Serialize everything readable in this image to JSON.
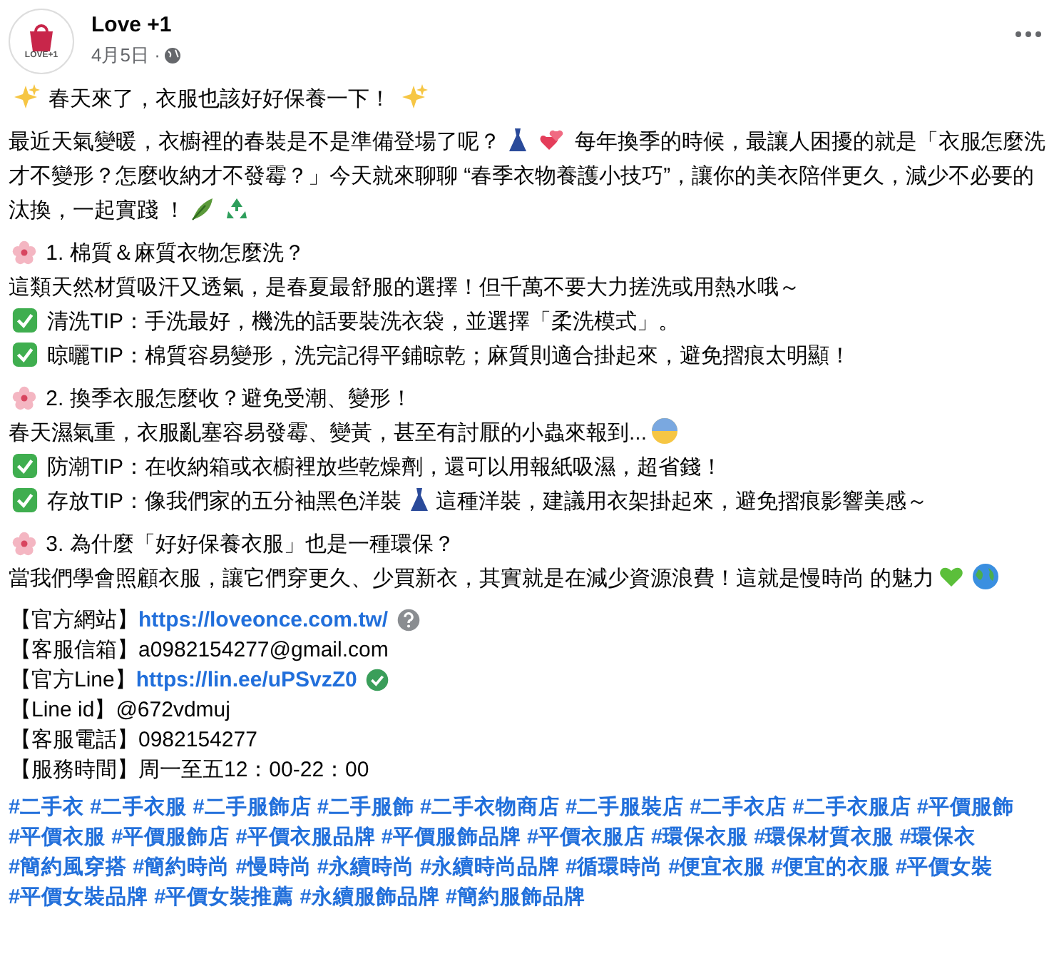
{
  "post": {
    "page_name": "Love +1",
    "date": "4月5日 ·",
    "avatar_text": "LOVE+1"
  },
  "title": "春天來了，衣服也該好好保養一下！",
  "intro": [
    "最近天氣變暖，衣櫥裡的春裝是不是準備登場了呢？",
    "每年換季的時候，最讓人困擾的就是「衣服怎麼洗才不變形？怎麼收納才不發霉？」今天就來聊聊 “春季衣物養護小技巧”，讓你的美衣陪伴更久，減少不必要的汰換，一起實踐 ！"
  ],
  "sections": [
    {
      "heading": "1. 棉質＆麻質衣物怎麼洗？",
      "body": "這類天然材質吸汗又透氣，是春夏最舒服的選擇！但千萬不要大力搓洗或用熱水哦～",
      "tips": [
        [
          "清洗TIP：手洗最好，機洗的話要裝洗衣袋，並選擇「柔洗模式」。"
        ],
        [
          "晾曬TIP：棉質容易變形，洗完記得平鋪晾乾；麻質則適合掛起來，避免摺痕太明顯！"
        ]
      ]
    },
    {
      "heading": "2. 換季衣服怎麼收？避免受潮、變形！",
      "body": "春天濕氣重，衣服亂塞容易發霉、變黃，甚至有討厭的小蟲來報到...",
      "tips": [
        [
          "防潮TIP：在收納箱或衣櫥裡放些乾燥劑，還可以用報紙吸濕，超省錢！"
        ],
        [
          "存放TIP：像我們家的五分袖黑色洋裝",
          "這種洋裝，建議用衣架掛起來，避免摺痕影響美感～"
        ]
      ]
    },
    {
      "heading": "3. 為什麼「好好保養衣服」也是一種環保？",
      "body": "當我們學會照顧衣服，讓它們穿更久、少買新衣，其實就是在減少資源浪費！這就是慢時尚 的魅力"
    }
  ],
  "contacts": [
    {
      "label": "【官方網站】",
      "value": "https://loveonce.com.tw/",
      "kind": "link"
    },
    {
      "label": "【客服信箱】",
      "value": "a0982154277@gmail.com",
      "kind": "plain"
    },
    {
      "label": "【官方Line】",
      "value": "https://lin.ee/uPSvzZ0",
      "kind": "link"
    },
    {
      "label": "【Line id】",
      "value": "@672vdmuj",
      "kind": "plain"
    },
    {
      "label": "【客服電話】",
      "value": "0982154277",
      "kind": "plain"
    },
    {
      "label": "【服務時間】",
      "value": "周一至五12：00-22：00",
      "kind": "plain"
    }
  ],
  "hashtags": [
    "#二手衣",
    "#二手衣服",
    "#二手服飾店",
    "#二手服飾",
    "#二手衣物商店",
    "#二手服裝店",
    "#二手衣店",
    "#二手衣服店",
    "#平價服飾",
    "#平價衣服",
    "#平價服飾店",
    "#平價衣服品牌",
    "#平價服飾品牌",
    "#平價衣服店",
    "#環保衣服",
    "#環保材質衣服",
    "#環保衣",
    "#簡約風穿搭",
    "#簡約時尚",
    "#慢時尚",
    "#永續時尚",
    "#永續時尚品牌",
    "#循環時尚",
    "#便宜衣服",
    "#便宜的衣服",
    "#平價女裝",
    "#平價女裝品牌",
    "#平價女裝推薦",
    "#永續服飾品牌",
    "#簡約服飾品牌"
  ]
}
